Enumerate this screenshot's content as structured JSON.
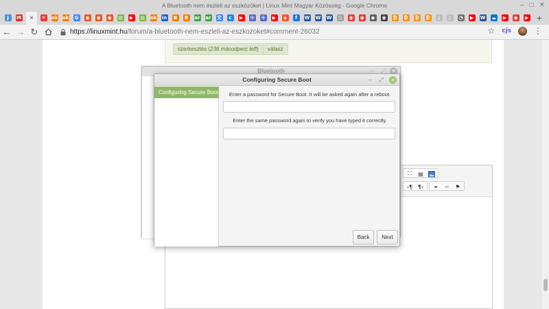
{
  "window": {
    "title": "A Bluetooth nem észleli az eszközöket | Linux Mint Magyar Közösség - Google Chrome"
  },
  "tabs": {
    "favicons": [
      {
        "name": "tab-favicon-chrome",
        "color": "#4a90d9",
        "glyph": "J"
      },
      {
        "name": "tab-favicon-gmail",
        "color": "#d93025",
        "glyph": "M"
      },
      {
        "name": "tab-active-close-icon",
        "active": true,
        "glyph": "×"
      },
      {
        "name": "tab-favicon-x",
        "color": "#e53935",
        "glyph": "✕"
      },
      {
        "name": "tab-favicon-orange-1",
        "color": "#f57c00",
        "glyph": "ok"
      },
      {
        "name": "tab-favicon-orange-2",
        "color": "#f57c00",
        "glyph": "ok"
      },
      {
        "name": "tab-favicon-google",
        "color": "#4285f4",
        "glyph": "G"
      },
      {
        "name": "tab-favicon-ubuntu-1",
        "color": "#e95420",
        "glyph": "◉"
      },
      {
        "name": "tab-favicon-ubuntu-2",
        "color": "#e95420",
        "glyph": "◉"
      },
      {
        "name": "tab-favicon-ubuntu-3",
        "color": "#e95420",
        "glyph": "◉"
      },
      {
        "name": "tab-favicon-green-1",
        "color": "#7cb342",
        "glyph": "▤"
      },
      {
        "name": "tab-favicon-youtube-1",
        "color": "#ff0000",
        "glyph": "▶"
      },
      {
        "name": "tab-favicon-green-2",
        "color": "#7cb342",
        "glyph": "▤"
      },
      {
        "name": "tab-favicon-orange-3",
        "color": "#f57c00",
        "glyph": "ok"
      },
      {
        "name": "tab-favicon-linkedin",
        "color": "#0a66c2",
        "glyph": "in"
      },
      {
        "name": "tab-favicon-blogger-1",
        "color": "#f57d00",
        "glyph": "B"
      },
      {
        "name": "tab-favicon-blogger-2",
        "color": "#f57d00",
        "glyph": "B"
      },
      {
        "name": "tab-favicon-green-3",
        "color": "#43a047",
        "glyph": "ar"
      },
      {
        "name": "tab-favicon-green-4",
        "color": "#43a047",
        "glyph": "ar"
      },
      {
        "name": "tab-favicon-translate",
        "color": "#4285f4",
        "glyph": "文"
      },
      {
        "name": "tab-favicon-blue-c",
        "color": "#1e88e5",
        "glyph": "c"
      },
      {
        "name": "tab-favicon-youtube-2",
        "color": "#ff0000",
        "glyph": "▶"
      },
      {
        "name": "tab-favicon-network-1",
        "color": "#5c6bc0",
        "glyph": "✣"
      },
      {
        "name": "tab-favicon-network-2",
        "color": "#5c6bc0",
        "glyph": "✣"
      },
      {
        "name": "tab-favicon-youtube-3",
        "color": "#ff0000",
        "glyph": "▶"
      },
      {
        "name": "tab-favicon-brave",
        "color": "#fb542b",
        "glyph": "◈"
      },
      {
        "name": "tab-favicon-facebook",
        "color": "#1877f2",
        "glyph": "f"
      },
      {
        "name": "tab-favicon-word-1",
        "color": "#2b579a",
        "glyph": "W"
      },
      {
        "name": "tab-favicon-word-2",
        "color": "#2b579a",
        "glyph": "W"
      },
      {
        "name": "tab-favicon-word-3",
        "color": "#2b579a",
        "glyph": "W"
      },
      {
        "name": "tab-favicon-grey-1",
        "color": "#9e9e9e",
        "glyph": "◳"
      },
      {
        "name": "tab-favicon-red-1",
        "color": "#e53935",
        "glyph": "◉"
      },
      {
        "name": "tab-favicon-red-2",
        "color": "#e53935",
        "glyph": "◉"
      },
      {
        "name": "tab-favicon-shield",
        "color": "#616161",
        "glyph": "◆"
      },
      {
        "name": "tab-favicon-dark-1",
        "color": "#424242",
        "glyph": "◉"
      },
      {
        "name": "tab-favicon-bitcoin-1",
        "color": "#f7931a",
        "glyph": "₿"
      },
      {
        "name": "tab-favicon-bitcoin-2",
        "color": "#f7931a",
        "glyph": "₿"
      },
      {
        "name": "tab-favicon-bitcoin-3",
        "color": "#f7931a",
        "glyph": "₿"
      },
      {
        "name": "tab-favicon-bitcoin-4",
        "color": "#f7931a",
        "glyph": "₿"
      },
      {
        "name": "tab-favicon-doc-1",
        "color": "#bdbdbd",
        "glyph": "▯"
      },
      {
        "name": "tab-favicon-doc-2",
        "color": "#bdbdbd",
        "glyph": "▯"
      },
      {
        "name": "tab-favicon-gauge",
        "color": "#757575",
        "glyph": "◔"
      },
      {
        "name": "tab-favicon-youtube-4",
        "color": "#ff0000",
        "glyph": "▶"
      },
      {
        "name": "tab-favicon-word-4",
        "color": "#2b579a",
        "glyph": "W"
      },
      {
        "name": "tab-favicon-onedrive",
        "color": "#0078d4",
        "glyph": "☁"
      },
      {
        "name": "tab-favicon-youtube-5",
        "color": "#ff0000",
        "glyph": "▶"
      },
      {
        "name": "tab-favicon-red-3",
        "color": "#e53935",
        "glyph": "◉"
      },
      {
        "name": "tab-favicon-youtube-6",
        "color": "#ff0000",
        "glyph": "▶"
      }
    ],
    "new_tab": "+"
  },
  "addressbar": {
    "host": "https://linuxmint.hu",
    "path": "/forum/a-bluetooth-nem-eszleli-az-eszkozoket#comment-26032",
    "ext_label": "cjs"
  },
  "page": {
    "edit_prefix": "szerkesztés (",
    "edit_time": "236 másodperc left",
    "edit_suffix": ")",
    "reply": "válasz"
  },
  "bluetooth_window": {
    "title": "Bluetooth"
  },
  "dialog": {
    "title": "Configuring Secure Boot",
    "sidebar_item": "Configuring Secure Boot",
    "prompt1": "Enter a password for Secure Boot. It will be asked again after a reboot.",
    "prompt2": "Enter the same password again to verify you have typed it correctly.",
    "back": "Back",
    "next": "Next"
  },
  "colors": {
    "accent": "#8fb866",
    "pill_bg": "#dfe6cf",
    "pill_text": "#5a7a2a"
  }
}
